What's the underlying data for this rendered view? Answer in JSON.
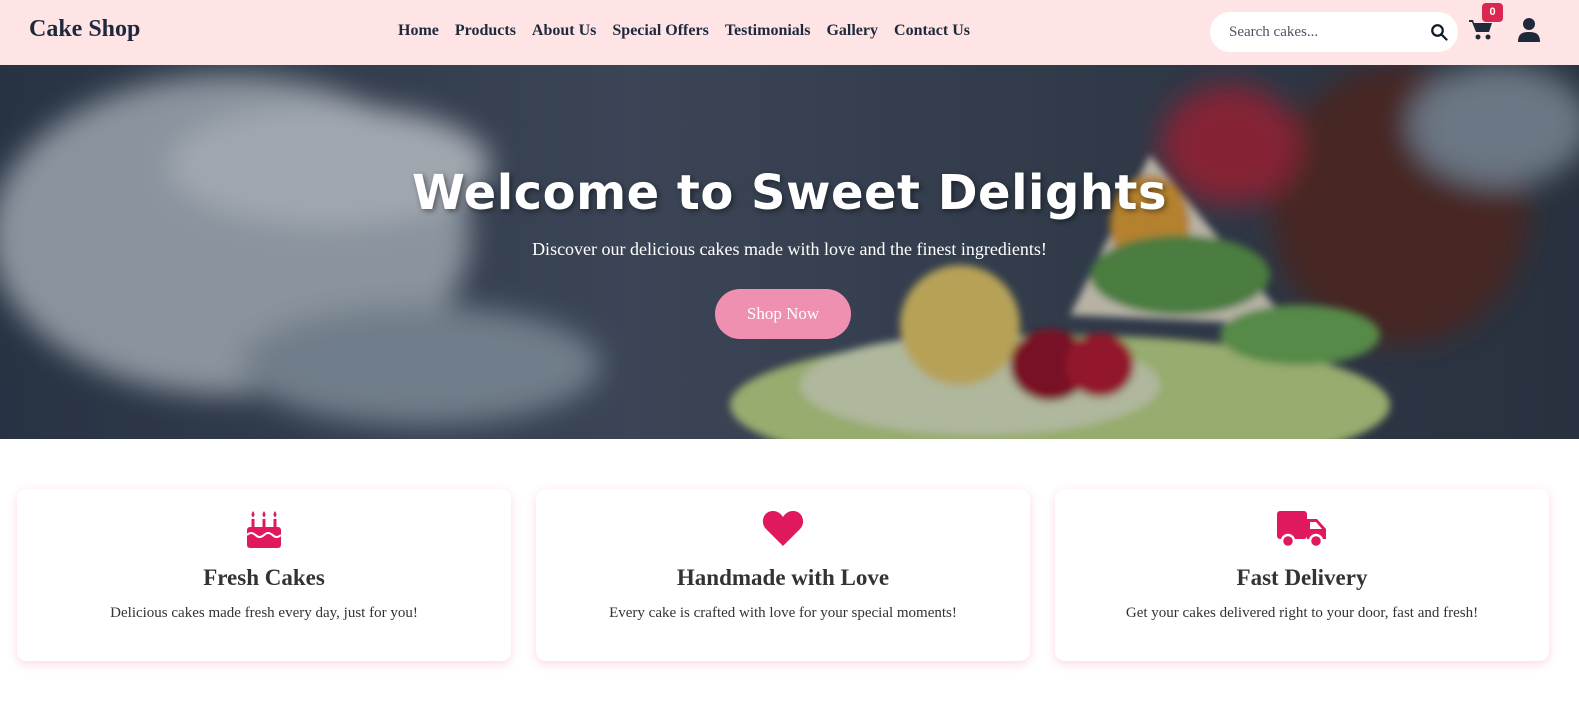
{
  "header": {
    "brand": "Cake Shop",
    "nav": [
      "Home",
      "Products",
      "About Us",
      "Special Offers",
      "Testimonials",
      "Gallery",
      "Contact Us"
    ],
    "search_placeholder": "Search cakes...",
    "cart_count": "0"
  },
  "hero": {
    "title": "Welcome to Sweet Delights",
    "subtitle": "Discover our delicious cakes made with love and the finest ingredients!",
    "cta": "Shop Now"
  },
  "features": [
    {
      "icon": "birthday-cake-icon",
      "title": "Fresh Cakes",
      "text": "Delicious cakes made fresh every day, just for you!"
    },
    {
      "icon": "heart-icon",
      "title": "Handmade with Love",
      "text": "Every cake is crafted with love for your special moments!"
    },
    {
      "icon": "truck-icon",
      "title": "Fast Delivery",
      "text": "Get your cakes delivered right to your door, fast and fresh!"
    }
  ],
  "colors": {
    "header_bg": "#ffe4e6",
    "accent": "#e0185e",
    "button": "#f090b0",
    "badge": "#dc2652"
  }
}
